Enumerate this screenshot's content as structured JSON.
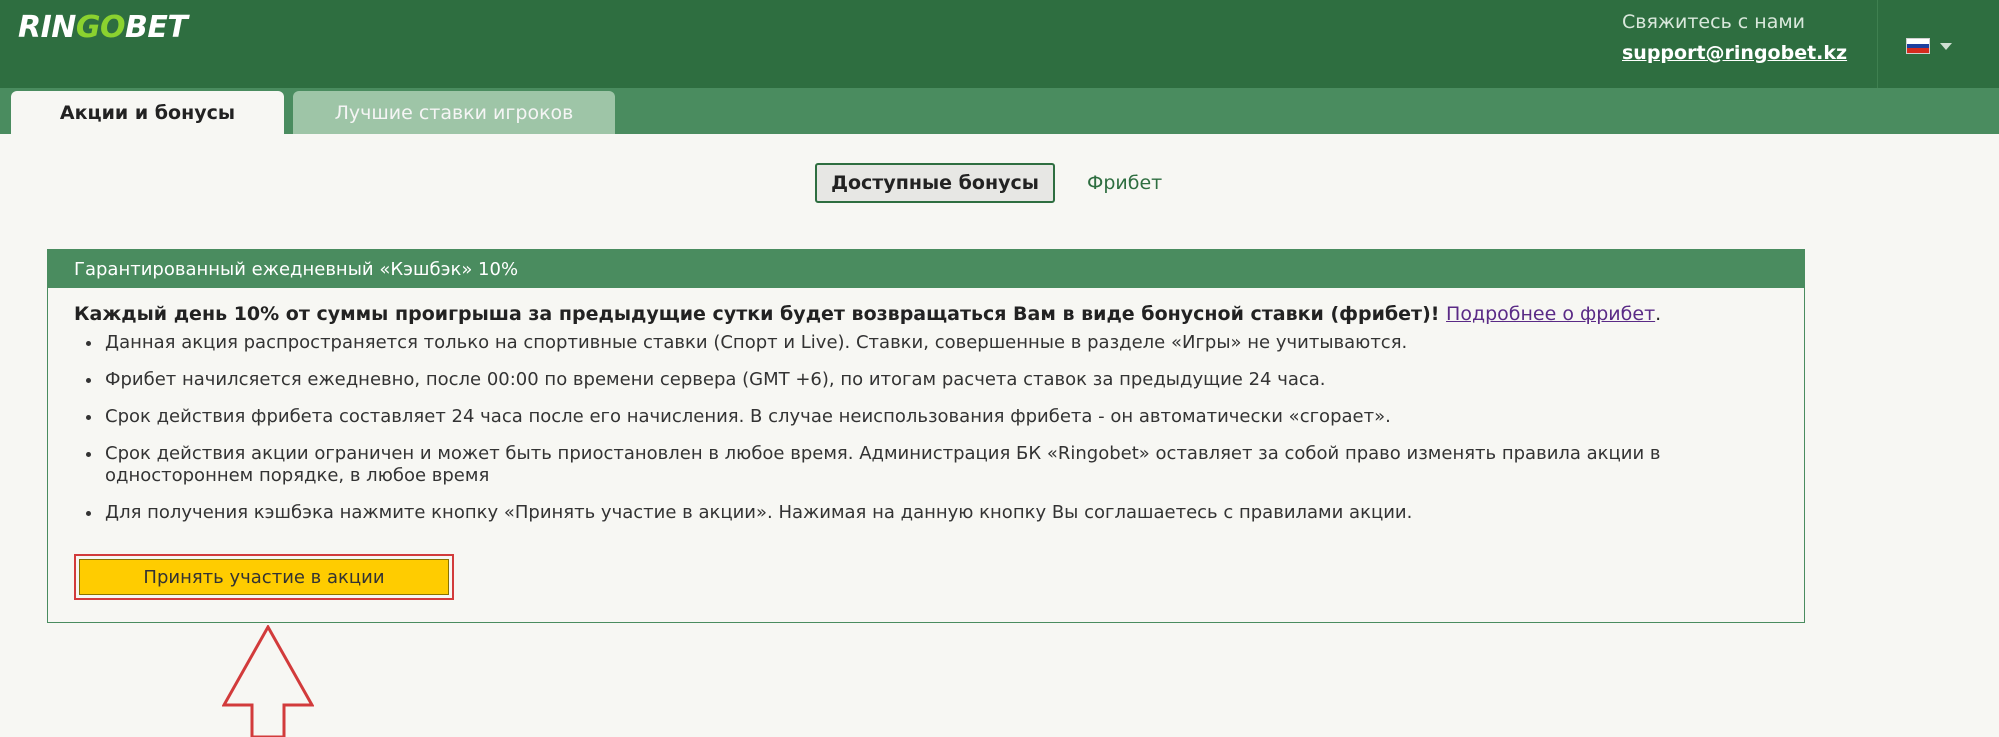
{
  "header": {
    "logo_ring": "RIN",
    "logo_go": "GO",
    "logo_bet": "BET",
    "contact_label": "Свяжитесь с нами",
    "contact_email": "support@ringobet.kz",
    "language_icon": "russia-flag-icon"
  },
  "tabs": [
    {
      "label": "Акции и бонусы",
      "active": true
    },
    {
      "label": "Лучшие ставки игроков",
      "active": false
    }
  ],
  "subtabs": {
    "available": "Доступные бонусы",
    "freebet": "Фрибет"
  },
  "promo": {
    "title": "Гарантированный ежедневный «Кэшбэк» 10%",
    "lead": "Каждый день 10% от суммы проигрыша за предыдущие сутки будет возвращаться Вам в виде бонусной ставки (фрибет)!",
    "more_link": "Подробнее о фрибет",
    "rules": [
      "Данная акция распространяется только на спортивные ставки (Спорт и Live). Ставки, совершенные в разделе «Игры» не учитываются.",
      "Фрибет начилсяется ежедневно, после 00:00 по времени сервера (GMT +6), по итогам расчета ставок за предыдущие 24 часа.",
      "Срок действия фрибета составляет 24 часа после его начисления. В случае неиспользования фрибета - он автоматически «сгорает».",
      "Срок действия акции ограничен и может быть приостановлен в любое время. Администрация БК «Ringobet» оставляет за собой право изменять правила акции в одностороннем порядке, в любое время",
      "Для получения кэшбэка нажмите кнопку «Принять участие в акции». Нажимая на данную кнопку Вы соглашаетесь с правилами акции."
    ],
    "cta_label": "Принять участие в акции"
  },
  "colors": {
    "header_bg": "#2e6e40",
    "tabbar_bg": "#4a8c5f",
    "cta_bg": "#ffcc00",
    "highlight": "#d23b3b"
  }
}
